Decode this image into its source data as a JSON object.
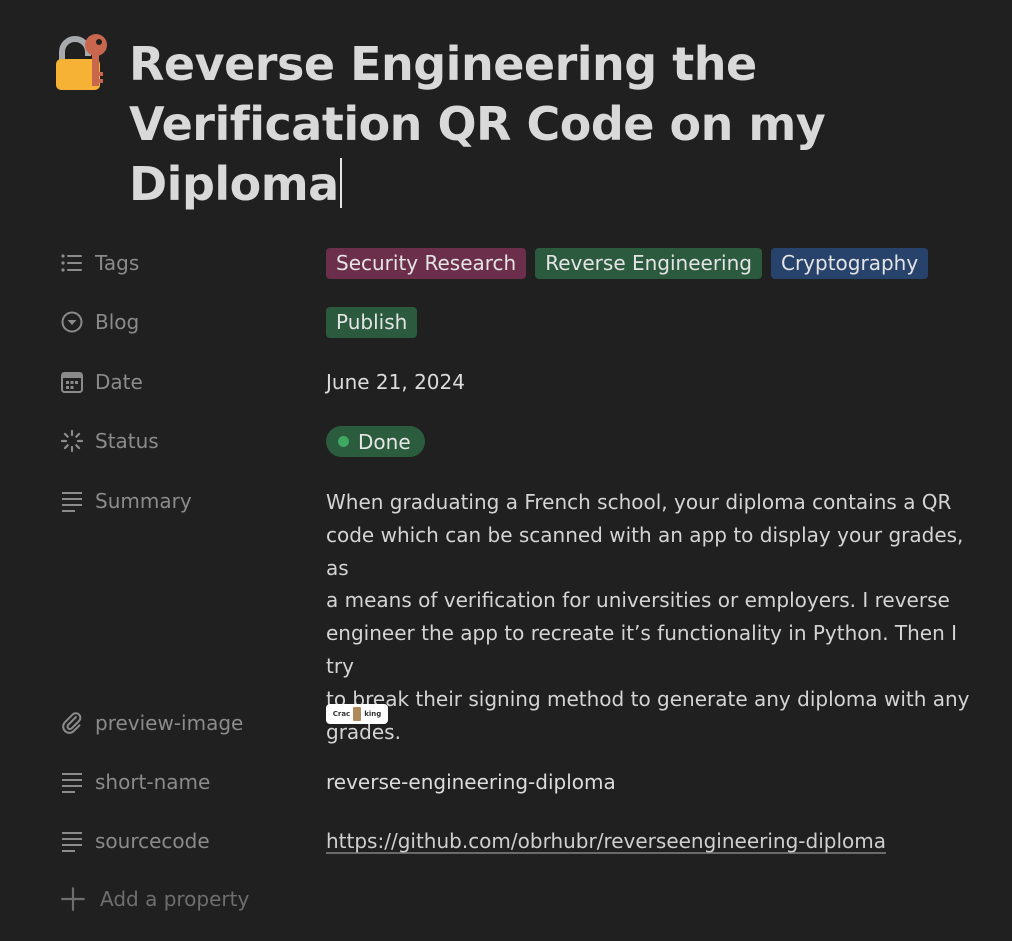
{
  "page": {
    "icon": "lock-with-key-icon",
    "title_parts": [
      "Reverse Engineering the",
      "Verification QR Code on my",
      "Diploma"
    ]
  },
  "properties": {
    "tags": {
      "label": "Tags",
      "icon": "list-icon",
      "items": [
        {
          "label": "Security Research",
          "color": "#6b2f4b"
        },
        {
          "label": "Reverse Engineering",
          "color": "#2c5a3f"
        },
        {
          "label": "Cryptography",
          "color": "#27436b"
        }
      ]
    },
    "blog": {
      "label": "Blog",
      "icon": "circle-chevron-down-icon",
      "value": "Publish",
      "color": "#2c5a3f"
    },
    "date": {
      "label": "Date",
      "icon": "calendar-icon",
      "value": "June 21, 2024"
    },
    "status": {
      "label": "Status",
      "icon": "status-spinner-icon",
      "value": "Done",
      "pill_color": "#2b5c3e",
      "dot_color": "#3fa862"
    },
    "summary": {
      "label": "Summary",
      "icon": "text-lines-icon",
      "lines": [
        "When graduating a French school, your diploma contains a QR",
        "code which can be scanned with an app to display your grades, as",
        "a means of verification for universities or employers. I reverse",
        "engineer the app to recreate it’s functionality in Python. Then I try",
        "to break their signing method to generate any diploma with any",
        "grades."
      ]
    },
    "preview_image": {
      "label": "preview-image",
      "icon": "paperclip-icon",
      "thumb_left": "Crac",
      "thumb_right": "king"
    },
    "short_name": {
      "label": "short-name",
      "icon": "text-lines-icon",
      "value": "reverse-engineering-diploma"
    },
    "sourcecode": {
      "label": "sourcecode",
      "icon": "text-lines-icon",
      "value": "https://github.com/obrhubr/reverseengineering-diploma"
    }
  },
  "add_property": {
    "label": "Add a property",
    "icon": "plus-icon"
  }
}
